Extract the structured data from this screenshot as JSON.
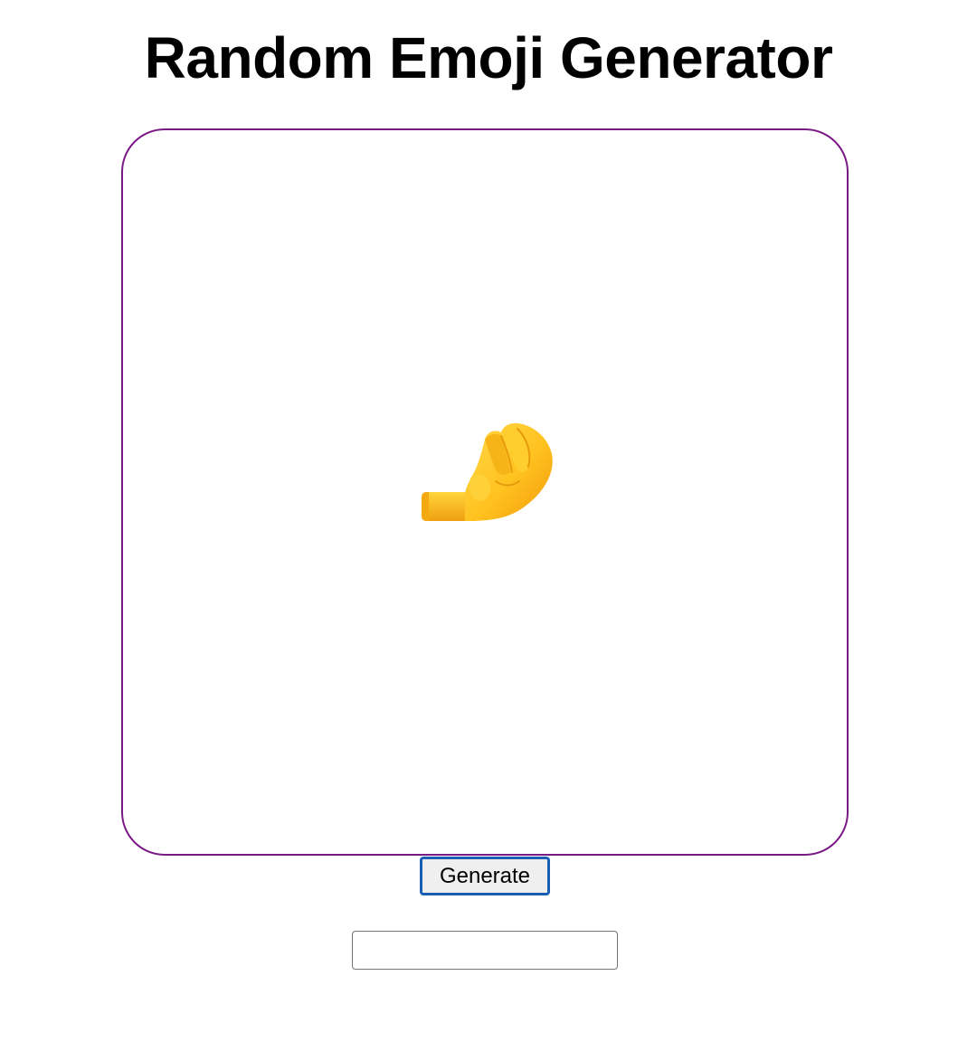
{
  "page": {
    "title": "Random Emoji Generator"
  },
  "emoji_display": {
    "current_emoji": "🤌",
    "icon": "pinched-fingers-icon",
    "border_color": "#7a1a86"
  },
  "controls": {
    "generate_label": "Generate",
    "generate_border_color": "#1a5fb4",
    "output_value": "",
    "output_placeholder": ""
  }
}
